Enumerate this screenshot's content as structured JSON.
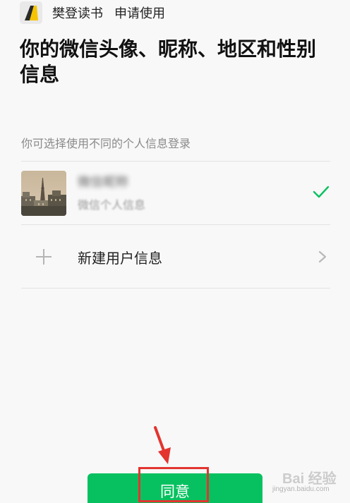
{
  "header": {
    "app_name": "樊登读书",
    "request_text": "申请使用",
    "logo_icon": "yellow-book-logo"
  },
  "title": "你的微信头像、昵称、地区和性别信息",
  "hint": "你可选择使用不同的个人信息登录",
  "profile": {
    "name": "微信昵称",
    "subtitle": "微信个人信息",
    "avatar_icon": "eiffel-tower-photo",
    "selected": true
  },
  "new_user": {
    "label": "新建用户信息",
    "icon": "plus-icon"
  },
  "agree_button": {
    "label": "同意"
  },
  "watermark": {
    "main": "Bai 经验",
    "sub": "jingyan.baidu.com"
  },
  "colors": {
    "accent": "#07c160",
    "annotation": "#e3342f",
    "background": "#f8f8f8"
  }
}
